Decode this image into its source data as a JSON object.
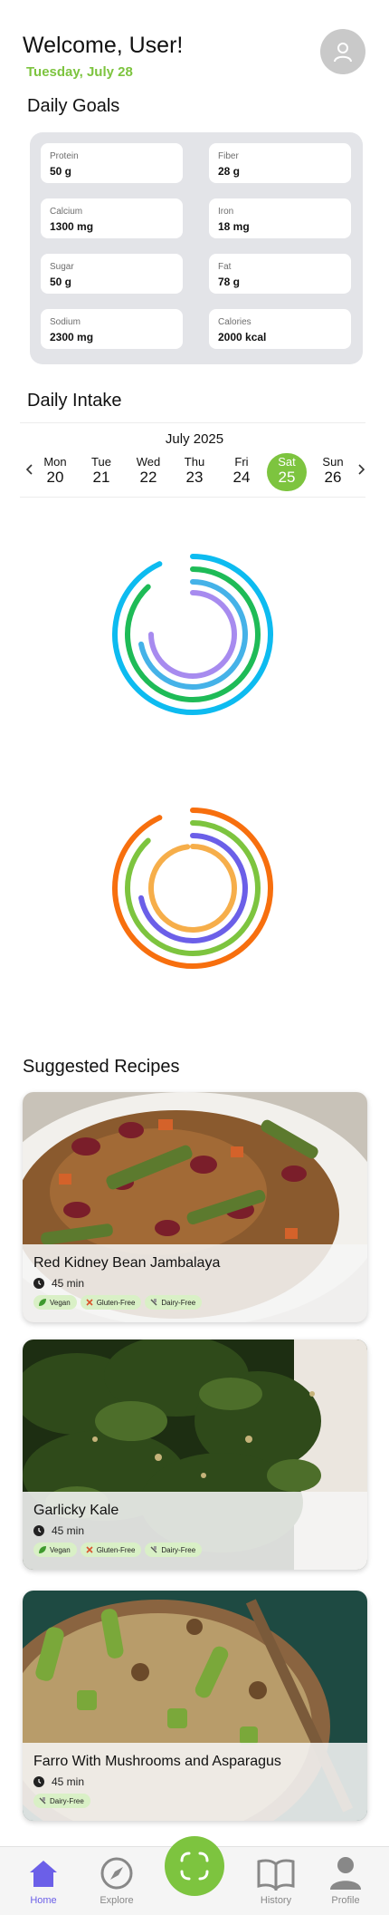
{
  "header": {
    "welcome": "Welcome, User!",
    "date": "Tuesday, July 28",
    "avatar_icon": "user-icon"
  },
  "daily_goals": {
    "title": "Daily Goals",
    "items": [
      {
        "label": "Protein",
        "value": "50 g"
      },
      {
        "label": "Fiber",
        "value": "28 g"
      },
      {
        "label": "Calcium",
        "value": "1300 mg"
      },
      {
        "label": "Iron",
        "value": "18 mg"
      },
      {
        "label": "Sugar",
        "value": "50 g"
      },
      {
        "label": "Fat",
        "value": "78 g"
      },
      {
        "label": "Sodium",
        "value": "2300 mg"
      },
      {
        "label": "Calories",
        "value": "2000 kcal"
      }
    ]
  },
  "daily_intake": {
    "title": "Daily Intake",
    "month": "July 2025",
    "days": [
      {
        "name": "Mon",
        "date": "20"
      },
      {
        "name": "Tue",
        "date": "21"
      },
      {
        "name": "Wed",
        "date": "22"
      },
      {
        "name": "Thu",
        "date": "23"
      },
      {
        "name": "Fri",
        "date": "24"
      },
      {
        "name": "Sat",
        "date": "25"
      },
      {
        "name": "Sun",
        "date": "26"
      }
    ],
    "selected_day_index": 5,
    "ring_groups": [
      {
        "rings": [
          {
            "color": "#0dbbf0",
            "fraction": 0.93
          },
          {
            "color": "#1ebb57",
            "fraction": 0.88
          },
          {
            "color": "#45b2e8",
            "fraction": 0.72
          },
          {
            "color": "#a78bef",
            "fraction": 0.75
          }
        ]
      },
      {
        "rings": [
          {
            "color": "#f76f0e",
            "fraction": 0.93
          },
          {
            "color": "#7dc43f",
            "fraction": 0.88
          },
          {
            "color": "#6b5fe8",
            "fraction": 0.72
          },
          {
            "color": "#f6ae4a",
            "fraction": 0.98
          }
        ]
      }
    ]
  },
  "recipes": {
    "title": "Suggested Recipes",
    "items": [
      {
        "name": "Red Kidney Bean Jambalaya",
        "time": "45 min",
        "tags": [
          {
            "label": "Vegan",
            "icon": "leaf-icon"
          },
          {
            "label": "Gluten-Free",
            "icon": "no-gluten-icon"
          },
          {
            "label": "Dairy-Free",
            "icon": "no-dairy-icon"
          }
        ]
      },
      {
        "name": "Garlicky Kale",
        "time": "45 min",
        "tags": [
          {
            "label": "Vegan",
            "icon": "leaf-icon"
          },
          {
            "label": "Gluten-Free",
            "icon": "no-gluten-icon"
          },
          {
            "label": "Dairy-Free",
            "icon": "no-dairy-icon"
          }
        ]
      },
      {
        "name": "Farro With Mushrooms and Asparagus",
        "time": "45 min",
        "tags": [
          {
            "label": "Dairy-Free",
            "icon": "no-dairy-icon"
          }
        ]
      }
    ]
  },
  "bottom_nav": {
    "items": [
      {
        "label": "Home",
        "icon": "home-icon"
      },
      {
        "label": "Explore",
        "icon": "compass-icon"
      },
      {
        "label": "History",
        "icon": "book-icon"
      },
      {
        "label": "Profile",
        "icon": "person-icon"
      }
    ],
    "scan_icon": "scan-icon",
    "active_index": 0
  },
  "colors": {
    "accent_green": "#7dc43f",
    "accent_purple": "#6b5fe8",
    "card_gray": "#e3e4e8"
  }
}
